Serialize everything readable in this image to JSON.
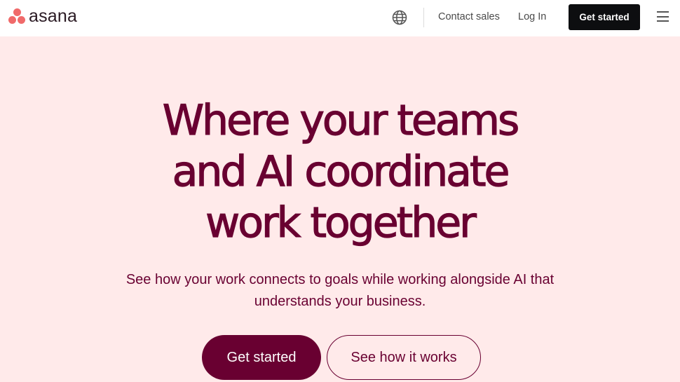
{
  "header": {
    "logo_text": "asana",
    "language_icon": "globe-icon",
    "contact_sales": "Contact sales",
    "log_in": "Log In",
    "cta": "Get started",
    "menu_icon": "hamburger-menu-icon"
  },
  "hero": {
    "headline_lines": [
      "Where your teams",
      "and AI coordinate",
      "work together"
    ],
    "subhead_lines": [
      "See how your work connects to goals while working alongside AI that",
      "understands your business."
    ],
    "primary_button": "Get started",
    "secondary_button": "See how it works"
  },
  "colors": {
    "brand_maroon": "#690031",
    "hero_bg": "#ffeaea",
    "logo_coral": "#f06a6a",
    "header_cta_bg": "#0d0e10"
  }
}
